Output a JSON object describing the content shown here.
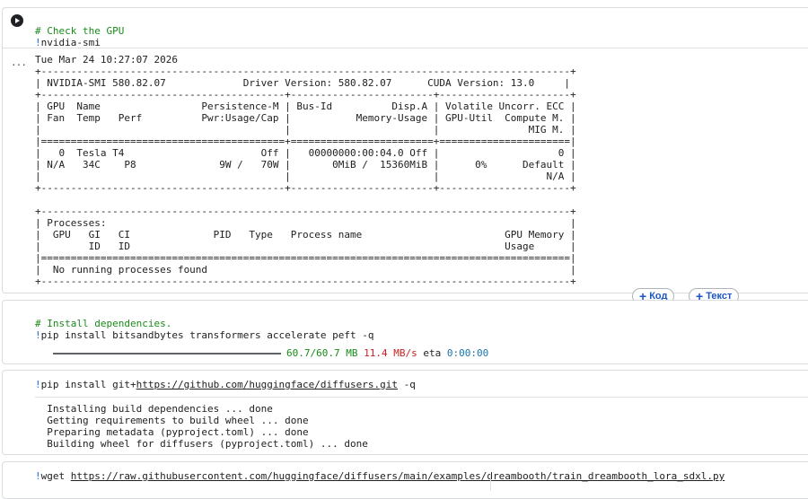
{
  "cells": {
    "gpu_check": {
      "code_lines": [
        {
          "comment": "# Check the GPU"
        },
        {
          "bang": "!",
          "text": "nvidia-smi"
        }
      ],
      "output_lines": [
        "Tue Mar 24 10:27:07 2026",
        "+-----------------------------------------------------------------------------------------+",
        "| NVIDIA-SMI 580.82.07             Driver Version: 580.82.07      CUDA Version: 13.0     |",
        "+-----------------------------------------+------------------------+----------------------+",
        "| GPU  Name                 Persistence-M | Bus-Id          Disp.A | Volatile Uncorr. ECC |",
        "| Fan  Temp   Perf          Pwr:Usage/Cap |           Memory-Usage | GPU-Util  Compute M. |",
        "|                                         |                        |               MIG M. |",
        "|=========================================+========================+======================|",
        "|   0  Tesla T4                       Off |   00000000:00:04.0 Off |                    0 |",
        "| N/A   34C    P8              9W /   70W |       0MiB /  15360MiB |      0%      Default |",
        "|                                         |                        |                  N/A |",
        "+-----------------------------------------+------------------------+----------------------+",
        "",
        "+-----------------------------------------------------------------------------------------+",
        "| Processes:                                                                              |",
        "|  GPU   GI   CI              PID   Type   Process name                        GPU Memory |",
        "|        ID   ID                                                               Usage      |",
        "|=========================================================================================|",
        "|  No running processes found                                                             |",
        "+-----------------------------------------------------------------------------------------+"
      ]
    },
    "install_deps": {
      "code_lines": [
        {
          "comment": "# Install dependencies."
        },
        {
          "bang": "!",
          "text": "pip install bitsandbytes transformers accelerate peft -q"
        }
      ],
      "progress": {
        "fraction": 1.0,
        "size": "60.7/60.7 MB",
        "speed": "11.4 MB/s",
        "eta_label": "eta",
        "eta": "0:00:00"
      }
    },
    "install_diffusers": {
      "bang": "!",
      "cmd_prefix": "pip install git+",
      "link": "https://github.com/huggingface/diffusers.git",
      "cmd_suffix": " -q",
      "output_lines": [
        "  Installing build dependencies ... done",
        "  Getting requirements to build wheel ... done",
        "  Preparing metadata (pyproject.toml) ... done",
        "  Building wheel for diffusers (pyproject.toml) ... done"
      ]
    },
    "wget": {
      "bang": "!",
      "cmd_prefix": "wget ",
      "link": "https://raw.githubusercontent.com/huggingface/diffusers/main/examples/dreambooth/train_dreambooth_lora_sdxl.py"
    }
  },
  "toolbar": {
    "add_code_label": "Код",
    "add_text_label": "Текст"
  },
  "icons": {
    "run": "play-icon",
    "output_menu": "ellipsis-icon",
    "add": "plus-icon"
  },
  "colors": {
    "comment": "#1a8a1a",
    "bang": "#1967d2",
    "progress_size": "#1a8a1a",
    "progress_speed": "#c5221f",
    "progress_eta": "#1a73a8",
    "button_text": "#1a56c4"
  }
}
